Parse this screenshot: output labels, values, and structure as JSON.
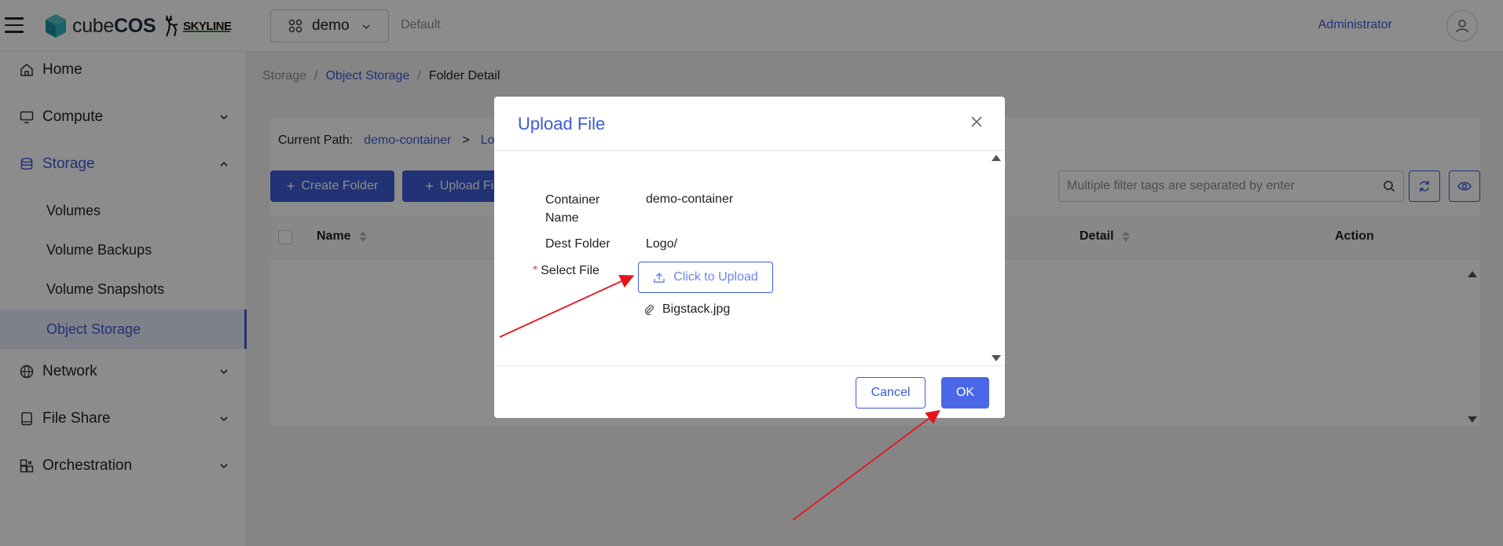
{
  "topbar": {
    "logo_word_regular": "cube",
    "logo_word_bold": "COS",
    "partner_logo": "SKYLINE",
    "project": "demo",
    "domain": "Default",
    "user": "Administrator"
  },
  "sidebar": {
    "items": [
      {
        "label": "Home",
        "icon": "home-icon"
      },
      {
        "label": "Compute",
        "icon": "monitor-icon"
      },
      {
        "label": "Storage",
        "icon": "database-icon"
      },
      {
        "label": "Network",
        "icon": "globe-icon"
      },
      {
        "label": "File Share",
        "icon": "file-icon"
      },
      {
        "label": "Orchestration",
        "icon": "puzzle-icon"
      }
    ],
    "storage_children": [
      "Volumes",
      "Volume Backups",
      "Volume Snapshots",
      "Object Storage"
    ]
  },
  "breadcrumb": {
    "root": "Storage",
    "section": "Object Storage",
    "current": "Folder Detail",
    "separator": "/"
  },
  "panel": {
    "path_label": "Current Path:",
    "path_container": "demo-container",
    "path_sep": ">",
    "path_folder_partial": "Lo",
    "create_folder": "Create Folder",
    "upload_file": "Upload File",
    "filter_placeholder": "Multiple filter tags are separated by enter",
    "columns": {
      "name": "Name",
      "detail": "Detail",
      "action": "Action"
    }
  },
  "modal": {
    "title": "Upload File",
    "container_label_1": "Container",
    "container_label_2": "Name",
    "container_value": "demo-container",
    "dest_label": "Dest Folder",
    "dest_value": "Logo/",
    "select_label": "Select File",
    "required_mark": "*",
    "upload_button": "Click to Upload",
    "file_name": "Bigstack.jpg",
    "cancel": "Cancel",
    "ok": "OK"
  },
  "colors": {
    "accent": "#3c5bd6",
    "annotation_arrow": "#e8141d",
    "required": "#f53f3f"
  }
}
